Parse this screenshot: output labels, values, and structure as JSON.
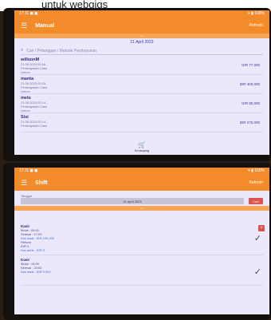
{
  "caption": "untuk webgigs",
  "top_screen": {
    "status_left": "17:11 ◼ ◼",
    "status_right": "▾ ▮ 100%",
    "menu_icon": "hamburger-icon",
    "title": "Manual",
    "action": "Refresh",
    "date": "21 April 2023",
    "search_placeholder": "Cari / Pelanggan / Metode Pembayaran",
    "items": [
      {
        "name": "willsonM",
        "line1": "21.05.2023 00:16",
        "line2": "Pembayaran Cash",
        "line3": "Umum",
        "amount": "IDR 77.000"
      },
      {
        "name": "manta",
        "line1": "21.05.2023 00:15",
        "line2": "Pembayaran Cash",
        "line3": "Umum",
        "amount": "IDR 400.000"
      },
      {
        "name": "mets",
        "line1": "21.05.2023 00:14",
        "line2": "Pembayaran Cash",
        "line3": "Umum",
        "amount": "IDR 80.000"
      },
      {
        "name": "Sisi",
        "line1": "21.05.2023 00:14",
        "line2": "Pembayaran Cash",
        "line3": "",
        "amount": "IDR 275.000"
      }
    ],
    "bottom_nav_label": "Keranjang"
  },
  "bottom_screen": {
    "status_left": "17:11 ◼ ◼",
    "status_right": "▾ ▮ 100%",
    "title": "Shift",
    "action": "Refresh",
    "field_label": "Tanggal",
    "field_value": "21 April 2023",
    "button_label": "Cari",
    "shifts": [
      {
        "title": "Kasir",
        "line1": "Mulai : 09:00",
        "line2": "Selesai : 17:00",
        "blue1": "Kas awal : IDR 100.000",
        "line3": "Refund",
        "line4": "IDR 0",
        "blue2": "Kas akhir : IDR 0"
      },
      {
        "title": "Kasir",
        "line1": "Mulai : 15:00",
        "line2": "Selesai : 23:00",
        "blue1": "Kas awal : IDR 0.000",
        "line3": "",
        "line4": "",
        "blue2": ""
      }
    ],
    "plus_label": "+"
  }
}
